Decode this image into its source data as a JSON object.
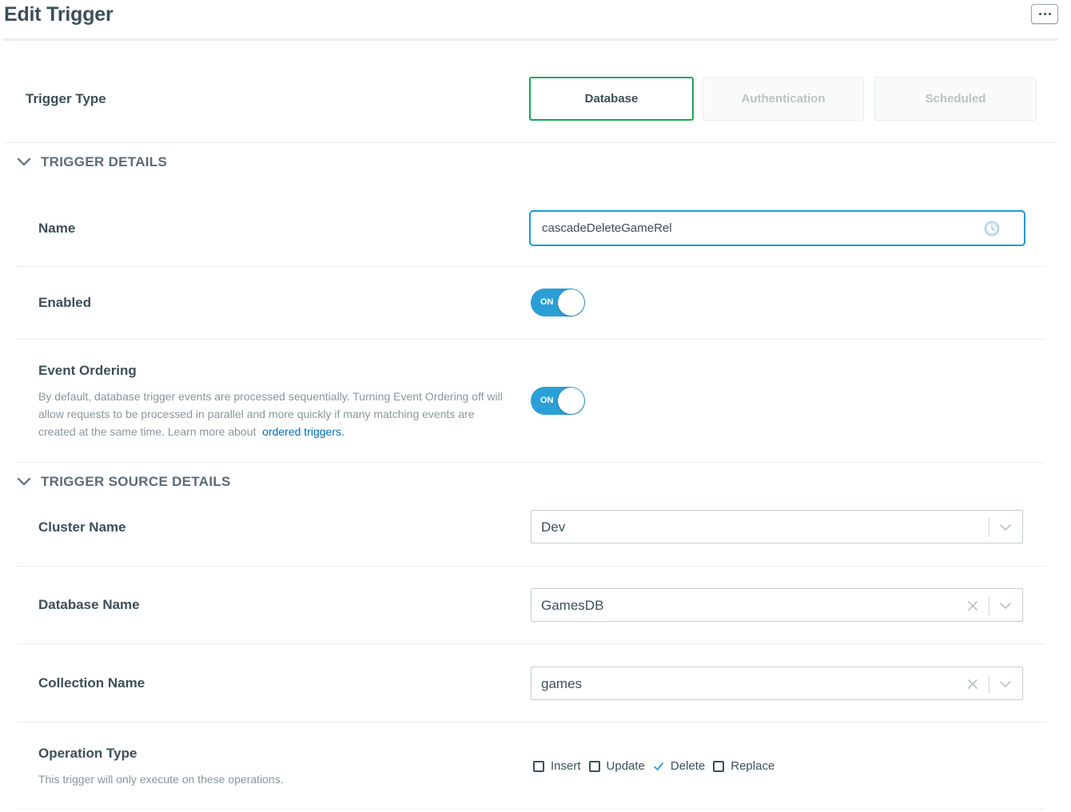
{
  "header": {
    "title": "Edit Trigger",
    "more_button_icon": "ellipsis-icon"
  },
  "trigger_type": {
    "label": "Trigger Type",
    "options": [
      {
        "label": "Database",
        "state": "selected"
      },
      {
        "label": "Authentication",
        "state": "disabled"
      },
      {
        "label": "Scheduled",
        "state": "disabled"
      }
    ]
  },
  "trigger_details": {
    "title": "TRIGGER DETAILS",
    "name": {
      "label": "Name",
      "value": "cascadeDeleteGameRel"
    },
    "enabled": {
      "label": "Enabled",
      "toggle_text": "ON",
      "value": true
    },
    "event_ordering": {
      "label": "Event Ordering",
      "description": "By default, database trigger events are processed sequentially. Turning Event Ordering off will allow requests to be processed in parallel and more quickly if many matching events are created at the same time. Learn more about",
      "link_text": "ordered triggers.",
      "toggle_text": "ON",
      "value": true
    }
  },
  "trigger_source_details": {
    "title": "TRIGGER SOURCE DETAILS",
    "cluster_name": {
      "label": "Cluster Name",
      "value": "Dev"
    },
    "database_name": {
      "label": "Database Name",
      "value": "GamesDB"
    },
    "collection_name": {
      "label": "Collection Name",
      "value": "games"
    },
    "operation_type": {
      "label": "Operation Type",
      "description": "This trigger will only execute on these operations.",
      "options": [
        {
          "label": "Insert",
          "checked": false
        },
        {
          "label": "Update",
          "checked": false
        },
        {
          "label": "Delete",
          "checked": true
        },
        {
          "label": "Replace",
          "checked": false
        }
      ]
    }
  },
  "colors": {
    "accent_green": "#13aa52",
    "focus_blue": "#1a9bd7",
    "toggle_blue": "#2a9fd6",
    "link_blue": "#006cbc",
    "text_dark": "#3d4f58"
  }
}
